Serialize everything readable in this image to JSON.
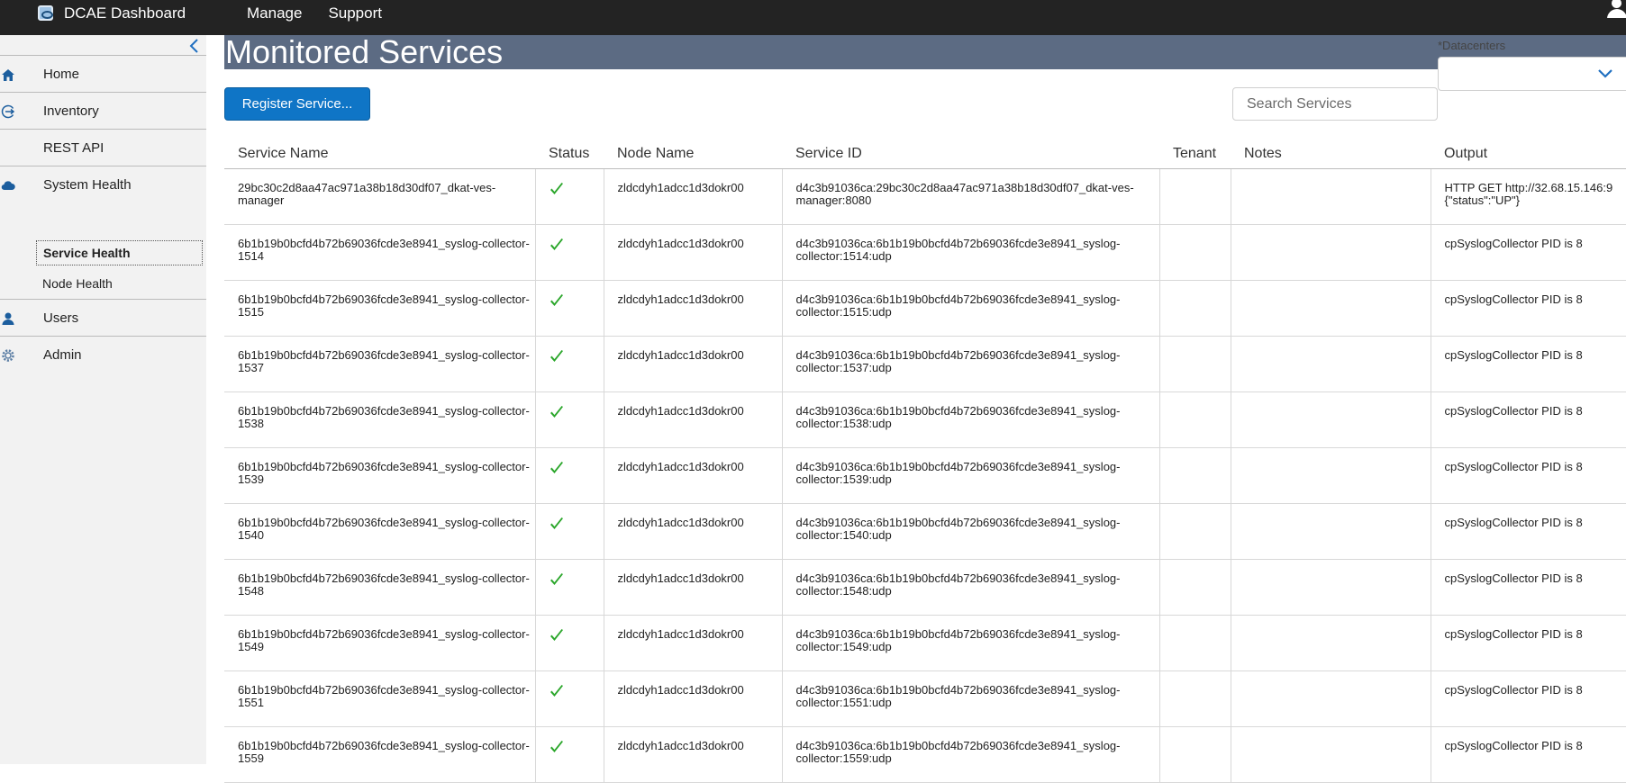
{
  "header": {
    "app_title": "DCAE Dashboard",
    "nav": [
      "Manage",
      "Support"
    ]
  },
  "sidebar": {
    "items": [
      {
        "label": "Home",
        "icon": "home-icon"
      },
      {
        "label": "Inventory",
        "icon": "inventory-icon"
      },
      {
        "label": "REST API",
        "icon": ""
      },
      {
        "label": "System Health",
        "icon": "cloud-icon"
      },
      {
        "label": "Users",
        "icon": "user-icon"
      },
      {
        "label": "Admin",
        "icon": "gear-icon"
      }
    ],
    "subitems": [
      {
        "label": "Service Health",
        "active": true
      },
      {
        "label": "Node Health",
        "active": false
      }
    ]
  },
  "main": {
    "title": "Monitored Services",
    "datacenters_label": "*Datacenters",
    "datacenters_value": "",
    "register_button": "Register Service...",
    "search_placeholder": "Search Services",
    "table": {
      "columns": [
        "Service Name",
        "Status",
        "Node Name",
        "Service ID",
        "Tenant",
        "Notes",
        "Output"
      ],
      "rows": [
        {
          "service_name": "29bc30c2d8aa47ac971a38b18d30df07_dkat-ves-manager",
          "status": "passing",
          "node": "zldcdyh1adcc1d3dokr00",
          "service_id": "d4c3b91036ca:29bc30c2d8aa47ac971a38b18d30df07_dkat-ves-manager:8080",
          "tenant": "",
          "notes": "",
          "output": "HTTP GET http://32.68.15.146:9\n{\"status\":\"UP\"}"
        },
        {
          "service_name": "6b1b19b0bcfd4b72b69036fcde3e8941_syslog-collector-1514",
          "status": "passing",
          "node": "zldcdyh1adcc1d3dokr00",
          "service_id": "d4c3b91036ca:6b1b19b0bcfd4b72b69036fcde3e8941_syslog-collector:1514:udp",
          "tenant": "",
          "notes": "",
          "output": "cpSyslogCollector PID is 8"
        },
        {
          "service_name": "6b1b19b0bcfd4b72b69036fcde3e8941_syslog-collector-1515",
          "status": "passing",
          "node": "zldcdyh1adcc1d3dokr00",
          "service_id": "d4c3b91036ca:6b1b19b0bcfd4b72b69036fcde3e8941_syslog-collector:1515:udp",
          "tenant": "",
          "notes": "",
          "output": "cpSyslogCollector PID is 8"
        },
        {
          "service_name": "6b1b19b0bcfd4b72b69036fcde3e8941_syslog-collector-1537",
          "status": "passing",
          "node": "zldcdyh1adcc1d3dokr00",
          "service_id": "d4c3b91036ca:6b1b19b0bcfd4b72b69036fcde3e8941_syslog-collector:1537:udp",
          "tenant": "",
          "notes": "",
          "output": "cpSyslogCollector PID is 8"
        },
        {
          "service_name": "6b1b19b0bcfd4b72b69036fcde3e8941_syslog-collector-1538",
          "status": "passing",
          "node": "zldcdyh1adcc1d3dokr00",
          "service_id": "d4c3b91036ca:6b1b19b0bcfd4b72b69036fcde3e8941_syslog-collector:1538:udp",
          "tenant": "",
          "notes": "",
          "output": "cpSyslogCollector PID is 8"
        },
        {
          "service_name": "6b1b19b0bcfd4b72b69036fcde3e8941_syslog-collector-1539",
          "status": "passing",
          "node": "zldcdyh1adcc1d3dokr00",
          "service_id": "d4c3b91036ca:6b1b19b0bcfd4b72b69036fcde3e8941_syslog-collector:1539:udp",
          "tenant": "",
          "notes": "",
          "output": "cpSyslogCollector PID is 8"
        },
        {
          "service_name": "6b1b19b0bcfd4b72b69036fcde3e8941_syslog-collector-1540",
          "status": "passing",
          "node": "zldcdyh1adcc1d3dokr00",
          "service_id": "d4c3b91036ca:6b1b19b0bcfd4b72b69036fcde3e8941_syslog-collector:1540:udp",
          "tenant": "",
          "notes": "",
          "output": "cpSyslogCollector PID is 8"
        },
        {
          "service_name": "6b1b19b0bcfd4b72b69036fcde3e8941_syslog-collector-1548",
          "status": "passing",
          "node": "zldcdyh1adcc1d3dokr00",
          "service_id": "d4c3b91036ca:6b1b19b0bcfd4b72b69036fcde3e8941_syslog-collector:1548:udp",
          "tenant": "",
          "notes": "",
          "output": "cpSyslogCollector PID is 8"
        },
        {
          "service_name": "6b1b19b0bcfd4b72b69036fcde3e8941_syslog-collector-1549",
          "status": "passing",
          "node": "zldcdyh1adcc1d3dokr00",
          "service_id": "d4c3b91036ca:6b1b19b0bcfd4b72b69036fcde3e8941_syslog-collector:1549:udp",
          "tenant": "",
          "notes": "",
          "output": "cpSyslogCollector PID is 8"
        },
        {
          "service_name": "6b1b19b0bcfd4b72b69036fcde3e8941_syslog-collector-1551",
          "status": "passing",
          "node": "zldcdyh1adcc1d3dokr00",
          "service_id": "d4c3b91036ca:6b1b19b0bcfd4b72b69036fcde3e8941_syslog-collector:1551:udp",
          "tenant": "",
          "notes": "",
          "output": "cpSyslogCollector PID is 8"
        },
        {
          "service_name": "6b1b19b0bcfd4b72b69036fcde3e8941_syslog-collector-1559",
          "status": "passing",
          "node": "zldcdyh1adcc1d3dokr00",
          "service_id": "d4c3b91036ca:6b1b19b0bcfd4b72b69036fcde3e8941_syslog-collector:1559:udp",
          "tenant": "",
          "notes": "",
          "output": "cpSyslogCollector PID is 8"
        }
      ]
    }
  },
  "colors": {
    "topbar": "#232323",
    "title_bar": "#5c6b83",
    "accent_blue": "#0f75c6",
    "status_ok": "#2aa62a",
    "sidebar_bg": "#f2f2f2"
  }
}
